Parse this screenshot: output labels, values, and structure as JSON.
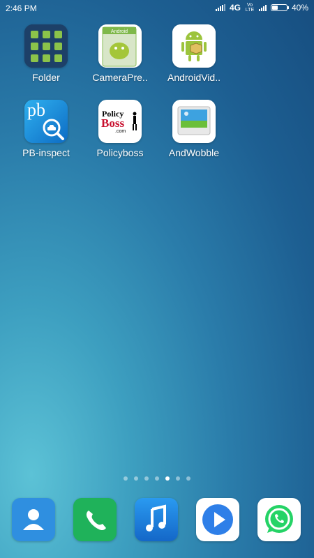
{
  "status_bar": {
    "time": "2:46 PM",
    "network": "4G",
    "volte": "Vo LTE",
    "battery": "40%",
    "battery_level": 0.4
  },
  "apps": [
    {
      "label": "Folder",
      "icon": "folder-icon"
    },
    {
      "label": "CameraPre..",
      "icon": "android-camera-icon"
    },
    {
      "label": "AndroidVid..",
      "icon": "android-box-icon"
    },
    {
      "label": "PB-inspect",
      "icon": "pb-search-car-icon",
      "icon_text": "pb"
    },
    {
      "label": "Policyboss",
      "icon": "policyboss-logo-icon",
      "icon_text_1": "Policy",
      "icon_text_2": "Boss",
      "icon_text_3": ".com"
    },
    {
      "label": "AndWobble",
      "icon": "picture-icon"
    }
  ],
  "page_indicator": {
    "count": 7,
    "active": 4
  },
  "dock": [
    {
      "name": "contacts",
      "icon": "contacts-icon",
      "color": "#2f8fe0"
    },
    {
      "name": "phone",
      "icon": "phone-icon",
      "color": "#1fb25a"
    },
    {
      "name": "music",
      "icon": "music-icon",
      "color": "#1e7fe0"
    },
    {
      "name": "video",
      "icon": "play-icon",
      "color": "#ffffff"
    },
    {
      "name": "whatsapp",
      "icon": "whatsapp-icon",
      "color": "#ffffff"
    }
  ]
}
